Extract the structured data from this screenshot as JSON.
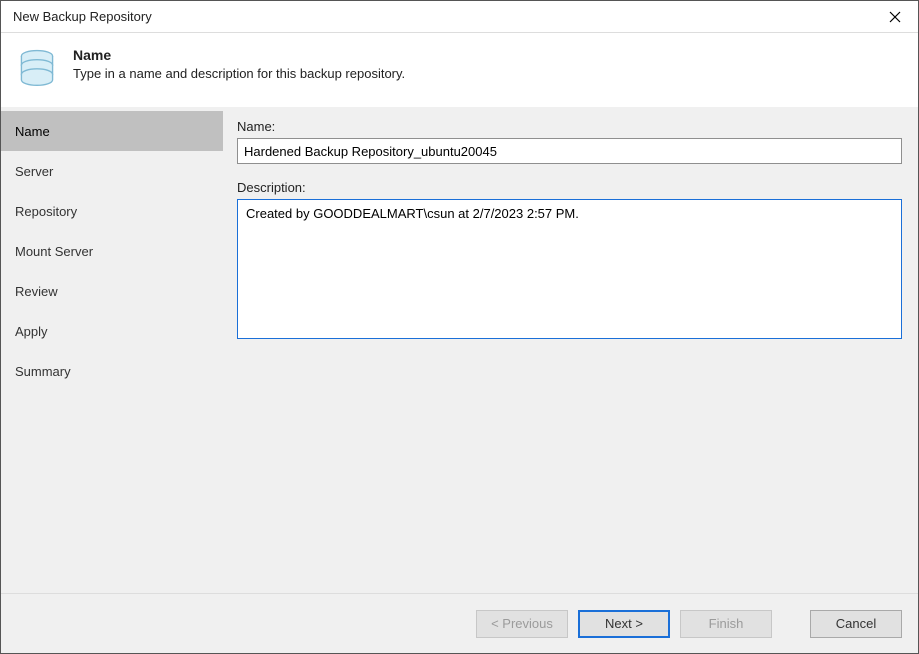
{
  "window": {
    "title": "New Backup Repository"
  },
  "header": {
    "title": "Name",
    "subtitle": "Type in a name and description for this backup repository."
  },
  "sidebar": {
    "items": [
      {
        "label": "Name",
        "active": true
      },
      {
        "label": "Server",
        "active": false
      },
      {
        "label": "Repository",
        "active": false
      },
      {
        "label": "Mount Server",
        "active": false
      },
      {
        "label": "Review",
        "active": false
      },
      {
        "label": "Apply",
        "active": false
      },
      {
        "label": "Summary",
        "active": false
      }
    ]
  },
  "form": {
    "name_label": "Name:",
    "name_value": "Hardened Backup Repository_ubuntu20045",
    "description_label": "Description:",
    "description_value": "Created by GOODDEALMART\\csun at 2/7/2023 2:57 PM."
  },
  "footer": {
    "previous_label": "< Previous",
    "next_label": "Next >",
    "finish_label": "Finish",
    "cancel_label": "Cancel"
  }
}
